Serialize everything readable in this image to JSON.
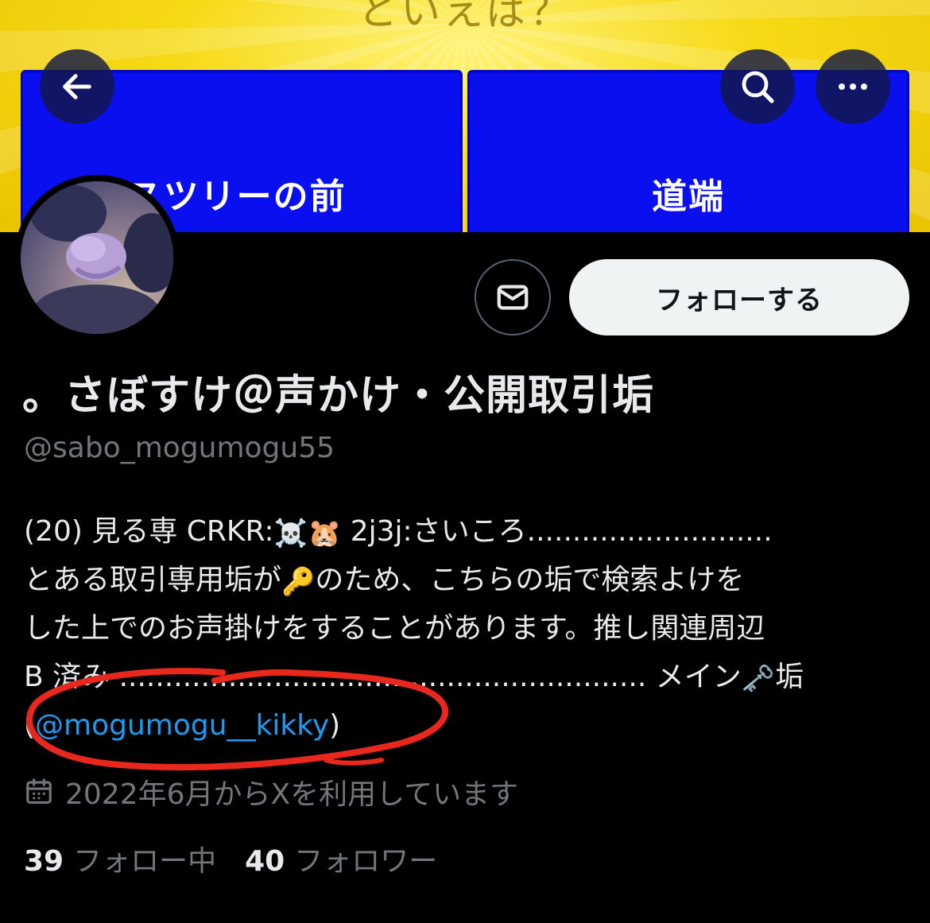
{
  "banner": {
    "headline": "といえば？",
    "choice_left": "スマスツリーの前",
    "choice_right": "道端"
  },
  "nav": {
    "back_icon": "arrow-left-icon",
    "search_icon": "search-icon",
    "more_icon": "more-icon"
  },
  "actions": {
    "message_icon": "envelope-icon",
    "follow_label": "フォローする"
  },
  "profile": {
    "display_name": "。さぼすけ＠声かけ・公開取引垢",
    "handle": "@sabo_mogumogu55",
    "bio": {
      "line1_a": "(20) 見る専 CRKR:",
      "line1_emoji1": "☠️",
      "line1_emoji2": "🐹",
      "line1_b": " 2j3j:さいころ...........................",
      "line2_a": "とある取引専用垢が",
      "line2_emoji": "🔑",
      "line2_b": "のため、こちらの垢で検索よけを",
      "line3": "した上でのお声掛けをすることがあります。推し関連周辺",
      "line4_a": "B 済み ..........................................................  メイン",
      "line4_emoji": "🗝️",
      "line4_b": "垢",
      "line5_prefix": "(",
      "link": "@mogumogu__kikky",
      "line5_suffix": ")"
    },
    "joined": "2022年6月からXを利用しています",
    "joined_icon": "calendar-icon",
    "following_count": "39",
    "following_label": "フォロー中",
    "followers_count": "40",
    "followers_label": "フォロワー"
  },
  "annotation_color": "#e8281c"
}
